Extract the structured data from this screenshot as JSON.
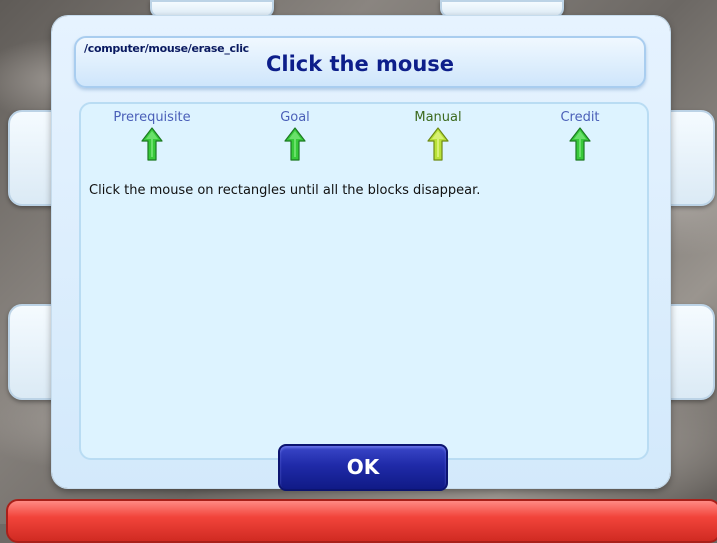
{
  "dialog": {
    "breadcrumb": "/computer/mouse/erase_clic",
    "title": "Click the mouse",
    "tabs": [
      {
        "label": "Prerequisite",
        "icon": "green-up-arrow-icon",
        "active": false
      },
      {
        "label": "Goal",
        "icon": "green-up-arrow-icon",
        "active": false
      },
      {
        "label": "Manual",
        "icon": "yellow-green-up-arrow-icon",
        "active": true
      },
      {
        "label": "Credit",
        "icon": "green-up-arrow-icon",
        "active": false
      }
    ],
    "description": "Click the mouse on rectangles until all the blocks disappear.",
    "ok_label": "OK"
  },
  "colors": {
    "title_text": "#0d1e8a",
    "tab_text": "#4a5fb8",
    "arrow_green": "#38c93a",
    "arrow_active": "#b9e23a",
    "ok_button": "#1f2aa8",
    "bottom_bar": "#e8413a"
  }
}
